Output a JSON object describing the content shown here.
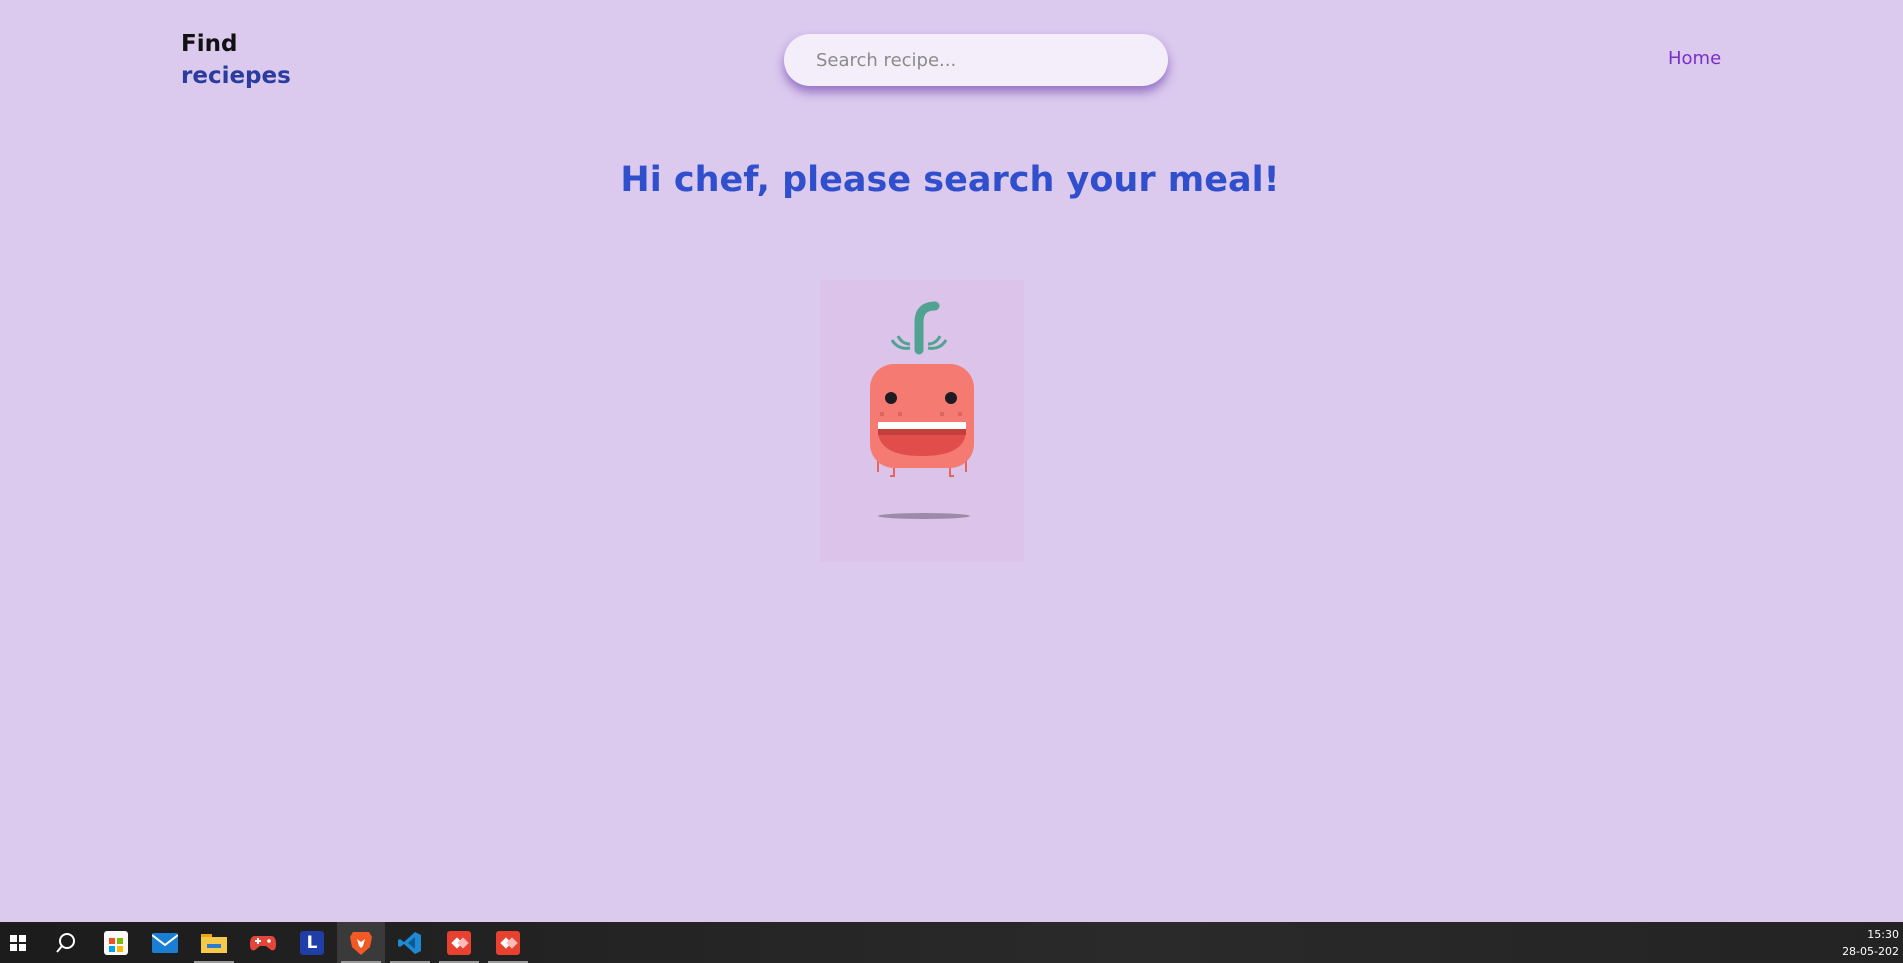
{
  "header": {
    "logo_line1": "Find",
    "logo_line2": "reciepes",
    "search_placeholder": "Search recipe...",
    "search_value": "",
    "nav_home": "Home"
  },
  "main": {
    "headline": "Hi chef, please search your meal!",
    "illustration": "smiling-tomato-character"
  },
  "colors": {
    "background": "#dbc9ee",
    "logo_accent": "#2a3d9f",
    "headline": "#2f4fcc",
    "nav_link": "#7b2fc9",
    "tomato_body": "#f47a72",
    "stem": "#4fa390"
  },
  "taskbar": {
    "items": [
      {
        "icon": "windows-start-icon"
      },
      {
        "icon": "search-icon"
      },
      {
        "icon": "store-icon"
      },
      {
        "icon": "mail-icon"
      },
      {
        "icon": "file-explorer-icon"
      },
      {
        "icon": "game-controller-icon"
      },
      {
        "icon": "app-l-icon",
        "glyph": "L"
      },
      {
        "icon": "brave-browser-icon"
      },
      {
        "icon": "vscode-icon"
      },
      {
        "icon": "anydesk-icon"
      },
      {
        "icon": "anydesk-icon"
      }
    ],
    "clock_time": "15:30",
    "clock_date": "28-05-202"
  }
}
